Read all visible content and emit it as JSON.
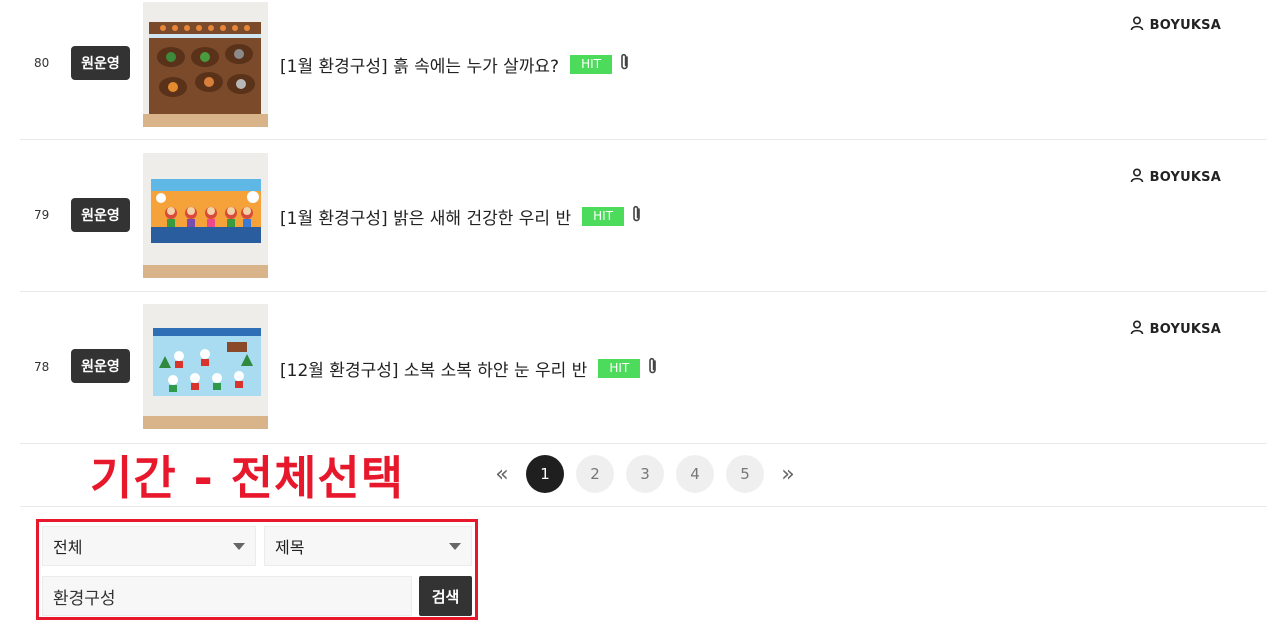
{
  "posts": [
    {
      "num": "80",
      "category": "원운영",
      "title": "[1월 환경구성] 흙 속에는 누가 살까요?",
      "hit": "HIT",
      "author": "BOYUKSA"
    },
    {
      "num": "79",
      "category": "원운영",
      "title": "[1월 환경구성] 밝은 새해 건강한 우리 반",
      "hit": "HIT",
      "author": "BOYUKSA"
    },
    {
      "num": "78",
      "category": "원운영",
      "title": "[12월 환경구성] 소복 소복 하얀 눈 우리 반",
      "hit": "HIT",
      "author": "BOYUKSA"
    }
  ],
  "annotation": "기간 - 전체선택",
  "pagination": {
    "prev": "«",
    "next": "»",
    "pages": [
      "1",
      "2",
      "3",
      "4",
      "5"
    ],
    "active": "1"
  },
  "search": {
    "period": "전체",
    "field": "제목",
    "query": "환경구성",
    "button": "검색"
  },
  "colors": {
    "hit": "#4ddb5b",
    "annotation": "#e8182c",
    "badge": "#333333"
  }
}
